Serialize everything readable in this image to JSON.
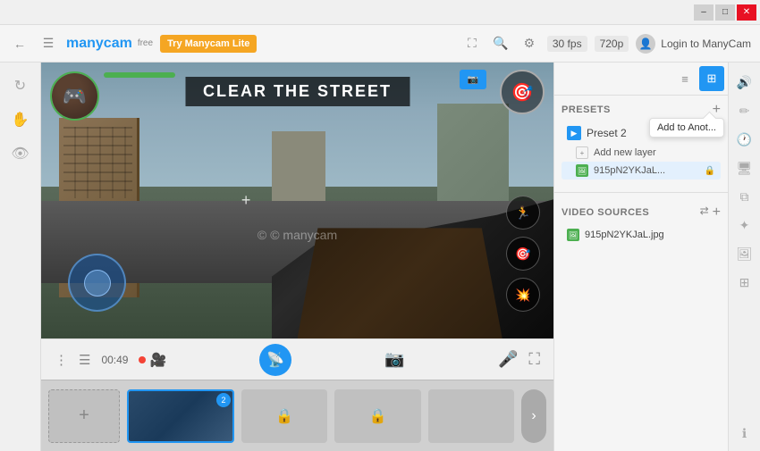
{
  "titleBar": {
    "minimize_label": "–",
    "restore_label": "□",
    "close_label": "✕"
  },
  "toolbar": {
    "brand": "manycam",
    "free_label": "free",
    "try_button": "Try Manycam Lite",
    "fps": "30 fps",
    "resolution": "720p",
    "login_label": "Login to ManyCam"
  },
  "tooltip": {
    "text": "Add to Anot..."
  },
  "gameScene": {
    "hud_title": "Clear THE STREET",
    "watermark": "© manycam",
    "time": "00:49"
  },
  "presets": {
    "section_title": "PRESETS",
    "preset_name": "Preset 2",
    "add_layer_label": "Add new layer",
    "layer_name": "915pN2YKJaL...",
    "add_icon": "+"
  },
  "videoSources": {
    "section_title": "VIDEO SOURCES",
    "source_name": "915pN2YKJaL.jpg"
  },
  "controls": {
    "three_dots": "⋮",
    "list_icon": "☰",
    "pause_icon": "⏸",
    "camera_icon": "🎥",
    "mic_icon": "🎤",
    "fullscreen_icon": "⛶"
  },
  "rightIcons": {
    "volume": "🔊",
    "brush": "✏",
    "clock": "🕐",
    "monitor": "🖥",
    "layers": "⧉",
    "magic": "✦",
    "image": "🖼",
    "grid": "⊞",
    "info": "ℹ"
  },
  "scenes": {
    "add_label": "+",
    "badge": "2",
    "next_arrow": "›"
  }
}
